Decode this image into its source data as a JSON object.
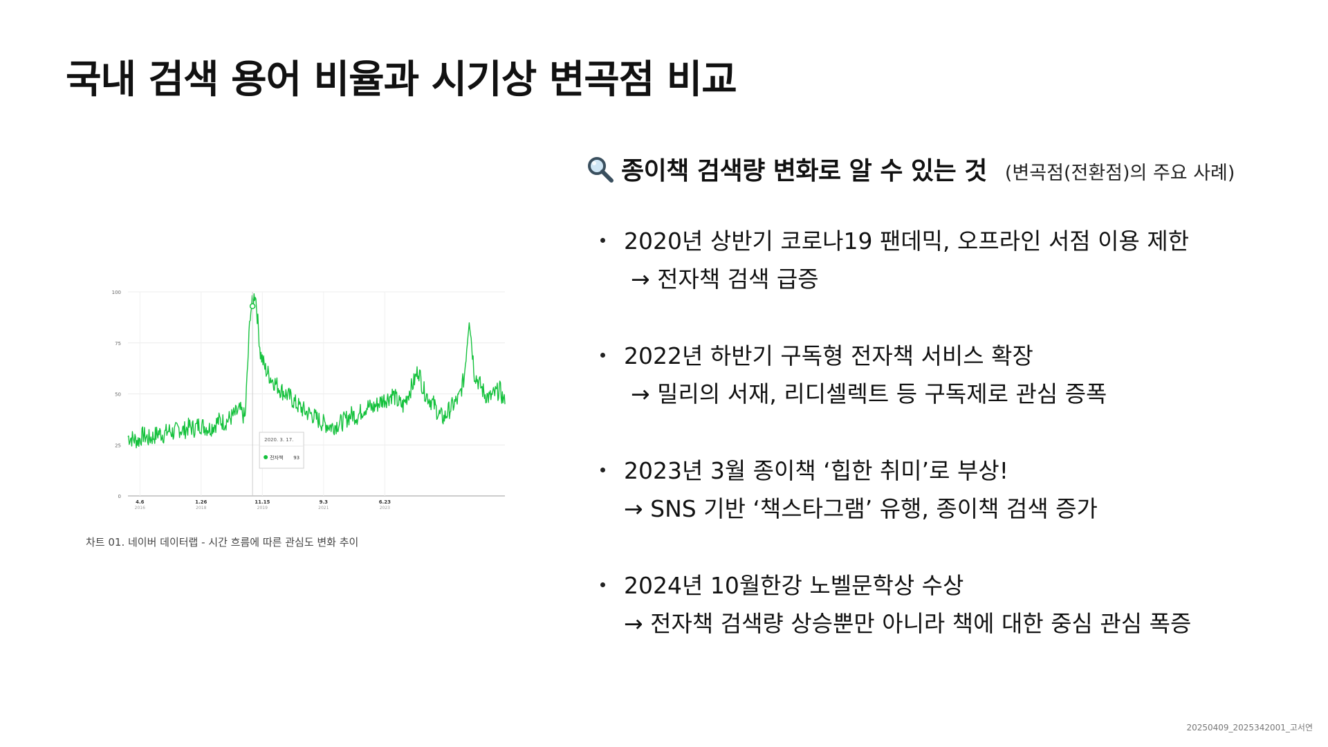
{
  "title": "국내 검색 용어 비율과 시기상 변곡점 비교",
  "chart": {
    "caption": "차트 01. 네이버 데이터랩 - 시간 흐름에 따른 관심도 변화 추이",
    "tooltip": {
      "date": "2020. 3. 17.",
      "series": "전자책",
      "value": "93"
    },
    "chart_data": {
      "type": "line",
      "y_ticks": [
        "100",
        "75",
        "50",
        "25",
        "0"
      ],
      "ylim": [
        0,
        100
      ],
      "grid": true,
      "x_ticks": [
        {
          "label": "4.6",
          "sub": "2016"
        },
        {
          "label": "1.26",
          "sub": "2018"
        },
        {
          "label": "11.15",
          "sub": "2019"
        },
        {
          "label": "9.3",
          "sub": "2021"
        },
        {
          "label": "6.23",
          "sub": "2023"
        }
      ],
      "series": [
        {
          "name": "전자책",
          "color": "#14c13c",
          "values": [
            29,
            28,
            27,
            30,
            28,
            29,
            31,
            30,
            32,
            31,
            33,
            32,
            34,
            33,
            35,
            34,
            33,
            35,
            37,
            36,
            38,
            40,
            42,
            38,
            90,
            100,
            70,
            62,
            58,
            55,
            52,
            50,
            48,
            45,
            43,
            41,
            40,
            38,
            36,
            35,
            34,
            35,
            36,
            38,
            40,
            39,
            42,
            44,
            43,
            45,
            47,
            48,
            50,
            46,
            44,
            50,
            55,
            62,
            52,
            48,
            45,
            40,
            38,
            42,
            45,
            48,
            58,
            88,
            60,
            55,
            50,
            48,
            50,
            52,
            45
          ]
        }
      ]
    }
  },
  "section": {
    "heading": "종이책 검색량 변화로 알 수 있는 것",
    "subheading": "(변곡점(전환점)의 주요 사례)",
    "icon": "magnifier-icon"
  },
  "bullets": [
    {
      "line1": "2020년 상반기 코로나19 팬데믹, 오프라인 서점 이용 제한",
      "line2": "→ 전자책 검색 급증"
    },
    {
      "line1": "2022년 하반기 구독형 전자책 서비스 확장",
      "line2": "→ 밀리의 서재, 리디셀렉트 등 구독제로 관심 증폭"
    },
    {
      "line1": "2023년 3월 종이책 ‘힙한 취미’로 부상!",
      "line2": "→ SNS 기반 ‘책스타그램’ 유행, 종이책 검색 증가"
    },
    {
      "line1": "2024년 10월한강 노벨문학상 수상",
      "line2": "→ 전자책 검색량 상승뿐만 아니라 책에 대한 중심 관심 폭증"
    }
  ],
  "footer": "20250409_2025342001_고서연"
}
